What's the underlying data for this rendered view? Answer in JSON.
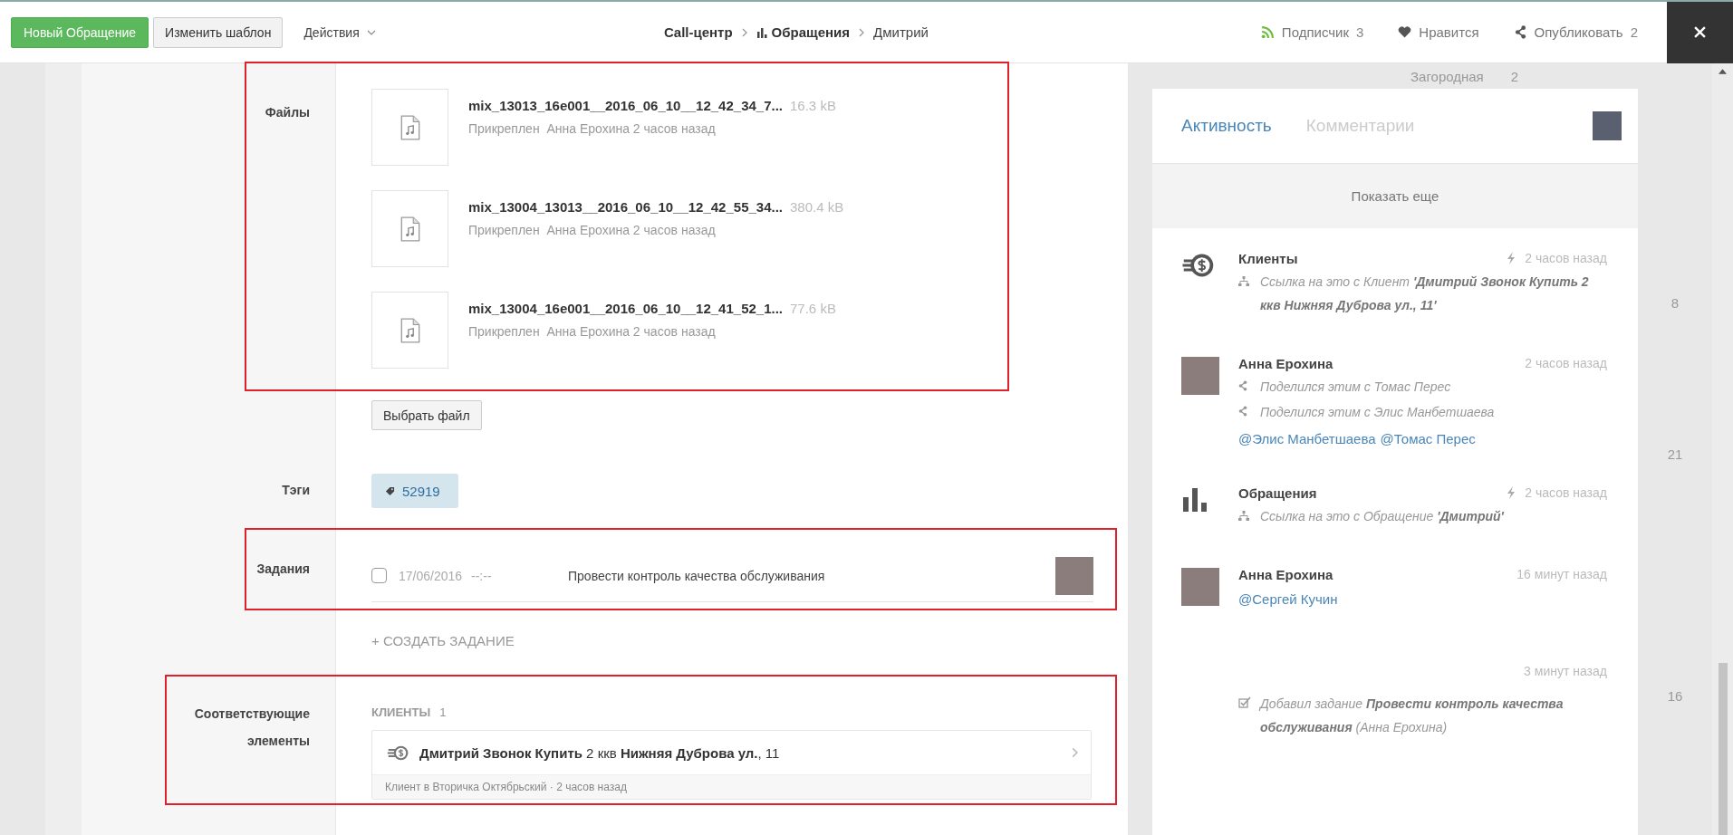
{
  "toolbar": {
    "primary_button": "Новый Обращение",
    "template_button": "Изменить шаблон",
    "actions_menu": "Действия"
  },
  "breadcrumb": [
    {
      "label": "Call-центр",
      "current": false,
      "icon": false
    },
    {
      "label": "Обращения",
      "current": false,
      "icon": true
    },
    {
      "label": "Дмитрий",
      "current": true,
      "icon": false
    }
  ],
  "top_actions": [
    {
      "kind": "subscribe",
      "label": "Подписчик",
      "count": "3"
    },
    {
      "kind": "like",
      "label": "Нравится"
    },
    {
      "kind": "share",
      "label": "Опубликовать",
      "count": "2"
    }
  ],
  "background_table": {
    "header": "Загородная",
    "header_count": "2",
    "counts": [
      "8",
      "21",
      "16"
    ]
  },
  "files": {
    "label": "Файлы",
    "items": [
      {
        "name": "mix_13013_16e001__2016_06_10__12_42_34_7...",
        "size": "16.3 kB",
        "meta": "Прикреплен  Анна Ерохина 2 часов назад"
      },
      {
        "name": "mix_13004_13013__2016_06_10__12_42_55_34...",
        "size": "380.4 kB",
        "meta": "Прикреплен  Анна Ерохина 2 часов назад"
      },
      {
        "name": "mix_13004_16e001__2016_06_10__12_41_52_1...",
        "size": "77.6 kB",
        "meta": "Прикреплен  Анна Ерохина 2 часов назад"
      }
    ],
    "choose_button": "Выбрать файл",
    "highlighted": true
  },
  "tags": {
    "label": "Тэги",
    "items": [
      "52919"
    ]
  },
  "tasks": {
    "label": "Задания",
    "highlighted": true,
    "items": [
      {
        "checked": false,
        "date": "17/06/2016",
        "time": "--:--",
        "text": "Провести контроль качества обслуживания"
      }
    ],
    "create_link": "+ СОЗДАТЬ ЗАДАНИЕ"
  },
  "related": {
    "label": "Соответствующие элементы",
    "highlighted": true,
    "group": "КЛИЕНТЫ",
    "count": "1",
    "card": {
      "title": "**Дмитрий Звонок Купить** 2 ккв **Нижняя Дуброва ул.**, 11",
      "subtitle": "Клиент в Вторичка Октябрьский · 2 часов назад"
    }
  },
  "activity": {
    "tabs": [
      {
        "label": "Активность",
        "selected": true
      },
      {
        "label": "Комментарии",
        "selected": false
      }
    ],
    "show_more": "Показать еще",
    "items": [
      {
        "kind": "coins",
        "title": "Клиенты",
        "time": "2 часов назад",
        "automatic": true,
        "lines": [
          {
            "kind": "link",
            "text": "Ссылка на это с Клиент **'Дмитрий Звонок Купить 2 ккв Нижняя Дуброва ул., 11'**"
          }
        ]
      },
      {
        "kind": "avatar",
        "title": "Анна Ерохина",
        "time": "2 часов назад",
        "automatic": false,
        "lines": [
          {
            "kind": "share",
            "text": "Поделился этим с Томас Перес"
          },
          {
            "kind": "share",
            "text": "Поделился этим с Элис Манбетшаева"
          }
        ],
        "mentions": [
          "@Элис Манбетшаева",
          "@Томас Перес"
        ]
      },
      {
        "kind": "chart",
        "title": "Обращения",
        "time": "2 часов назад",
        "automatic": true,
        "lines": [
          {
            "kind": "link",
            "text": "Ссылка на это с Обращение **'Дмитрий'**"
          }
        ]
      },
      {
        "kind": "avatar",
        "title": "Анна Ерохина",
        "time": "16 минут назад",
        "automatic": false,
        "mentions": [
          "@Сергей Кучин"
        ]
      },
      {
        "kind": "none",
        "time": "3 минут назад",
        "automatic": false,
        "lines": [
          {
            "kind": "task",
            "text": "Добавил задание **Провести контроль качества обслуживания** (Анна Ерохина)"
          }
        ]
      }
    ]
  }
}
